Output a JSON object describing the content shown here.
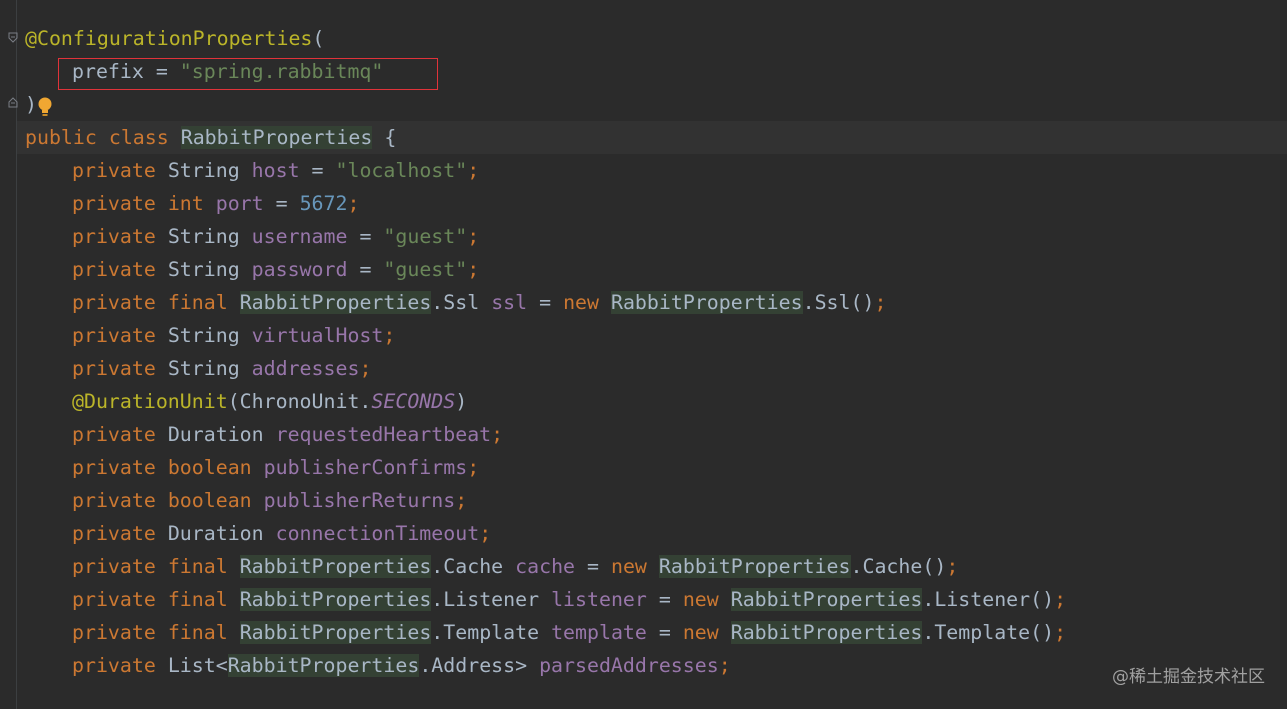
{
  "code": {
    "annotation": "@ConfigurationProperties",
    "open_paren": "(",
    "prefix_key": "prefix",
    "equals": " = ",
    "prefix_value": "\"spring.rabbitmq\"",
    "close_paren": ")",
    "class_decl": {
      "kw_public": "public",
      "kw_class": "class",
      "name": "RabbitProperties",
      "brace": "{"
    },
    "fields": [
      {
        "mods": [
          "private"
        ],
        "type": "String",
        "name": "host",
        "init": "\"localhost\"",
        "init_kind": "string"
      },
      {
        "mods": [
          "private",
          "int"
        ],
        "name": "port",
        "init": "5672",
        "init_kind": "number"
      },
      {
        "mods": [
          "private"
        ],
        "type": "String",
        "name": "username",
        "init": "\"guest\"",
        "init_kind": "string"
      },
      {
        "mods": [
          "private"
        ],
        "type": "String",
        "name": "password",
        "init": "\"guest\"",
        "init_kind": "string"
      },
      {
        "mods": [
          "private",
          "final"
        ],
        "outer": "RabbitProperties",
        "inner": ".Ssl",
        "name": "ssl",
        "new_kw": "new",
        "new_outer": "RabbitProperties",
        "new_inner": ".Ssl()"
      },
      {
        "mods": [
          "private"
        ],
        "type": "String",
        "name": "virtualHost"
      },
      {
        "mods": [
          "private"
        ],
        "type": "String",
        "name": "addresses"
      },
      {
        "annotation": "@DurationUnit",
        "arg_type": "ChronoUnit.",
        "arg_const": "SECONDS"
      },
      {
        "mods": [
          "private"
        ],
        "type": "Duration",
        "name": "requestedHeartbeat"
      },
      {
        "mods": [
          "private",
          "boolean"
        ],
        "name": "publisherConfirms"
      },
      {
        "mods": [
          "private",
          "boolean"
        ],
        "name": "publisherReturns"
      },
      {
        "mods": [
          "private"
        ],
        "type": "Duration",
        "name": "connectionTimeout"
      },
      {
        "mods": [
          "private",
          "final"
        ],
        "outer": "RabbitProperties",
        "inner": ".Cache",
        "name": "cache",
        "new_kw": "new",
        "new_outer": "RabbitProperties",
        "new_inner": ".Cache()"
      },
      {
        "mods": [
          "private",
          "final"
        ],
        "outer": "RabbitProperties",
        "inner": ".Listener",
        "name": "listener",
        "new_kw": "new",
        "new_outer": "RabbitProperties",
        "new_inner": ".Listener()"
      },
      {
        "mods": [
          "private",
          "final"
        ],
        "outer": "RabbitProperties",
        "inner": ".Template",
        "name": "template",
        "new_kw": "new",
        "new_outer": "RabbitProperties",
        "new_inner": ".Template()"
      },
      {
        "mods": [
          "private"
        ],
        "type": "List<",
        "generic_outer": "RabbitProperties",
        "generic_inner": ".Address>",
        "name": "parsedAddresses"
      }
    ]
  },
  "watermark": "@稀土掘金技术社区",
  "colors": {
    "background": "#2b2b2b",
    "keyword": "#cc7832",
    "annotation": "#bbb529",
    "string": "#6a8759",
    "number": "#6897bb",
    "field": "#9876aa",
    "text": "#a9b7c6",
    "highlight_box": "#e0333a"
  },
  "icons": [
    "fold-open-icon",
    "fold-close-icon",
    "lightbulb-icon"
  ]
}
